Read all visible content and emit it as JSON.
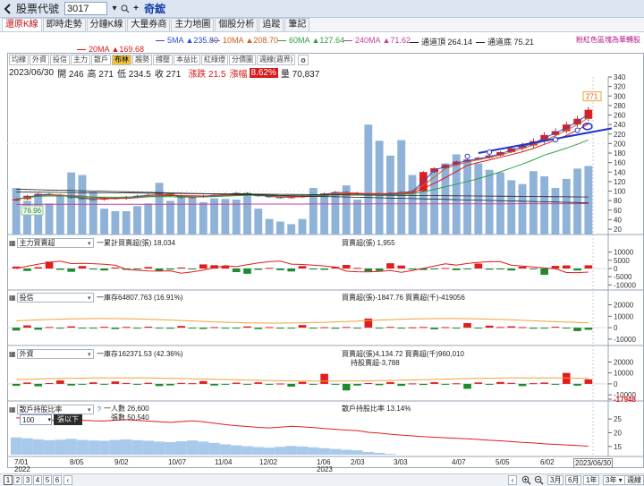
{
  "header": {
    "title": "股票代號",
    "stock_code": "3017",
    "stock_name": "奇鋐"
  },
  "tabs": [
    {
      "label": "還原K線",
      "active": true
    },
    {
      "label": "即時走勢"
    },
    {
      "label": "分鐘K線"
    },
    {
      "label": "大量券商"
    },
    {
      "label": "主力地圖"
    },
    {
      "label": "個股分析"
    },
    {
      "label": "追蹤"
    },
    {
      "label": "筆記"
    }
  ],
  "ma_legend": [
    {
      "label": "5MA ▲235.80",
      "color": "#2a4fd6"
    },
    {
      "label": "10MA ▲208.70",
      "color": "#d35a1e"
    },
    {
      "label": "60MA ▲127.64",
      "color": "#2f9e44"
    },
    {
      "label": "240MA ▲71.62",
      "color": "#c0409c"
    },
    {
      "label": "通道頂 264.14",
      "color": "#222222"
    },
    {
      "label": "通道底 75.21",
      "color": "#222222"
    },
    {
      "label": "20MA ▲169.68",
      "color": "#d61b1b"
    }
  ],
  "gap_note": "粉紅色區塊為華轉股",
  "subtoolbar": [
    "均線",
    "外資",
    "投信",
    "主力",
    "散戶",
    "布林",
    "趨勢",
    "撐壓",
    "本益比",
    "紅綠燈",
    "分價圖",
    "週線(週界)"
  ],
  "subtoolbar_active_index": 5,
  "quote": {
    "date": "2023/06/30",
    "open": "開 246",
    "high": "高 271",
    "low": "低 234.5",
    "close": "收 271",
    "change": "漲跌 21.5",
    "pct_label": "漲幅",
    "pct": "8.62%",
    "volume": "量 70,837"
  },
  "price_flag": "271",
  "low_flag": "76.96",
  "price_axis": [
    "340",
    "320",
    "300",
    "280",
    "260",
    "240",
    "220",
    "200",
    "180",
    "160",
    "140",
    "120",
    "100",
    "80",
    "60",
    "40",
    "20"
  ],
  "panels": {
    "main_force": {
      "select": "主力買賣超",
      "note1": "一累計買賣超(張) 18,034",
      "note2": "買賣超(張) 1,955",
      "axis": [
        "10000",
        "5000",
        "0",
        "-5000",
        "-10000"
      ]
    },
    "trust": {
      "select": "投信",
      "note1": "一庫存64807.763 (16.91%)",
      "note2": "買賣超(張)-1847.76 買賣超(千)-419056",
      "axis": [
        "20000",
        "10000",
        "0",
        "-10000"
      ]
    },
    "foreign": {
      "select": "外資",
      "note1": "一庫存162371.53 (42.36%)",
      "note2": "買賣超(張)4,134.72 買賣超(千)960,010",
      "note3": "持股賣超-3,788",
      "axis": [
        "20000",
        "10000",
        "0",
        "-10000",
        "-17948"
      ]
    },
    "retail": {
      "select": "散戶持股比率",
      "note1": "一人數 26,600",
      "note1b": "張數 50,540",
      "note2": "散戶持股比率 13.14%",
      "axis": [
        "25",
        "20",
        "15"
      ],
      "threshold_value": "100",
      "threshold_button": "張以下"
    }
  },
  "x_axis": [
    {
      "label": "7/01",
      "sub": "2022"
    },
    {
      "label": "8/05"
    },
    {
      "label": "9/02"
    },
    {
      "label": "10/07"
    },
    {
      "label": "11/04"
    },
    {
      "label": "12/02"
    },
    {
      "label": "1/06",
      "sub": "2023"
    },
    {
      "label": "2/03"
    },
    {
      "label": "3/03"
    },
    {
      "label": "4/07"
    },
    {
      "label": "5/05"
    },
    {
      "label": "6/02"
    },
    {
      "label": "2023/06/30"
    }
  ],
  "pages": [
    "1",
    "2",
    "3",
    "4",
    "5",
    "6"
  ],
  "range_buttons": [
    "3月",
    "6月",
    "1年",
    "3年",
    "週線"
  ],
  "chart_data": {
    "type": "candlestick",
    "interval": "weekly",
    "count": 53,
    "ohlc_close": [
      86,
      84,
      83,
      80,
      83,
      90,
      94,
      92,
      90,
      86,
      84,
      82,
      86,
      84,
      88,
      90,
      92,
      94,
      90,
      86,
      88,
      90,
      92,
      94,
      96,
      92,
      90,
      88,
      86,
      88,
      90,
      92,
      95,
      98,
      96,
      94,
      92,
      94,
      96,
      98,
      100,
      140,
      148,
      155,
      162,
      166,
      170,
      175,
      182,
      190,
      196,
      205,
      218,
      226,
      240,
      252,
      271
    ],
    "volume": [
      72,
      52,
      62,
      48,
      60,
      96,
      92,
      66,
      40,
      36,
      36,
      44,
      48,
      80,
      52,
      60,
      56,
      50,
      56,
      55,
      54,
      60,
      40,
      24,
      20,
      16,
      24,
      72,
      62,
      64,
      76,
      54,
      170,
      145,
      122,
      146,
      92,
      88,
      102,
      110,
      124,
      116,
      110,
      100,
      96,
      84,
      78,
      98,
      90,
      72,
      86,
      102,
      106
    ],
    "main_force": [
      1200,
      -1500,
      800,
      4200,
      -800,
      -2000,
      1500,
      -600,
      -1200,
      600,
      -800,
      -300,
      900,
      -1500,
      -700,
      600,
      -500,
      2500,
      2000,
      1400,
      -2200,
      -3200,
      -800,
      400,
      -1000,
      -1800,
      1500,
      -600,
      -800,
      1000,
      2200,
      400,
      -1800,
      -1500,
      3200,
      1800,
      -600,
      -900,
      -500,
      300,
      -1000,
      -400,
      3000,
      -700,
      -600,
      -1200,
      1100,
      -400,
      -3800,
      1600,
      1900,
      -1200,
      1955
    ],
    "trust": [
      -2500,
      2000,
      -1800,
      600,
      -800,
      1200,
      -600,
      -400,
      800,
      -1200,
      700,
      -300,
      900,
      -400,
      -900,
      1500,
      -600,
      -1100,
      500,
      -700,
      -300,
      1100,
      -1200,
      500,
      -800,
      -300,
      2300,
      -500,
      400,
      -900,
      600,
      -700,
      8000,
      -400,
      700,
      -500,
      300,
      600,
      -1400,
      500,
      -700,
      4000,
      -300,
      1800,
      600,
      1200,
      500,
      -900,
      -500,
      800,
      -400,
      -3000,
      -1848
    ],
    "foreign": [
      -1800,
      1200,
      -2200,
      700,
      3100,
      -1500,
      -800,
      1400,
      -600,
      2200,
      800,
      -400,
      1000,
      -2000,
      -1400,
      900,
      600,
      2500,
      -1500,
      -800,
      1100,
      -500,
      1400,
      -700,
      300,
      -2500,
      1800,
      -300,
      9200,
      -500,
      -6000,
      -1500,
      700,
      -1200,
      1600,
      -1800,
      400,
      -1000,
      1500,
      -600,
      500,
      -4500,
      1300,
      -800,
      1700,
      900,
      -2000,
      600,
      1200,
      -800,
      10000,
      -1600,
      4135
    ],
    "retail_pct": [
      23.5,
      23.2,
      22.8,
      22.5,
      22.7,
      23.0,
      22.6,
      22.4,
      22.3,
      22.6,
      22.8,
      22.5,
      22.3,
      22.0,
      21.8,
      22.1,
      22.4,
      22.0,
      21.5,
      21.0,
      20.6,
      20.3,
      20.0,
      19.8,
      20.1,
      20.4,
      20.2,
      19.9,
      19.6,
      19.3,
      19.0,
      18.8,
      18.2,
      17.9,
      17.5,
      17.2,
      16.9,
      16.6,
      16.4,
      16.2,
      16.0,
      15.8,
      15.6,
      15.3,
      15.1,
      14.8,
      14.5,
      14.3,
      14.0,
      13.8,
      13.6,
      13.4,
      13.14
    ]
  }
}
